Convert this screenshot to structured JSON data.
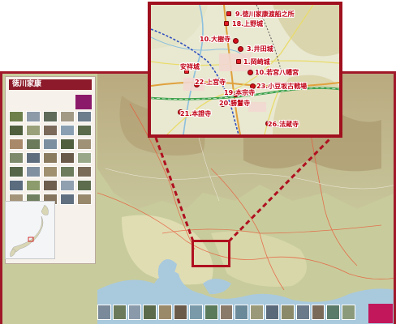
{
  "panel": {
    "title": "徳川家康",
    "subtitle": "",
    "badge": ""
  },
  "colors": {
    "accent": "#a0182a",
    "pin": "#d10f1a"
  },
  "callout_sites": [
    {
      "id": "site-9",
      "label": "9.徳川家康渡船之所"
    },
    {
      "id": "site-18",
      "label": "18.上野城"
    },
    {
      "id": "site-10b",
      "label": "10.大樹寺"
    },
    {
      "id": "site-3",
      "label": "3.井田城"
    },
    {
      "id": "site-1",
      "label": "1.岡崎城"
    },
    {
      "id": "site-anjo",
      "label": "安祥城"
    },
    {
      "id": "site-10",
      "label": "10.若宮八幡宮"
    },
    {
      "id": "site-22",
      "label": "22.上宮寺"
    },
    {
      "id": "site-23",
      "label": "23.小豆坂古戦場"
    },
    {
      "id": "site-19",
      "label": "19.本宗寺"
    },
    {
      "id": "site-20",
      "label": "20.勝鬘寺"
    },
    {
      "id": "site-21",
      "label": "21.本證寺"
    },
    {
      "id": "site-26",
      "label": "26.法蔵寺"
    }
  ],
  "photo_colors": [
    "#6d7f4a",
    "#8d9aa8",
    "#5f6b5a",
    "#a39a86",
    "#6e7d8c",
    "#4f5f3e",
    "#9aa07a",
    "#7b6a5a",
    "#8aa0b2",
    "#5a6a4a",
    "#a88a6a",
    "#6a7a5a",
    "#7c8fa0",
    "#50603f",
    "#9f9277",
    "#7e8a6c",
    "#5e6e7e",
    "#8a7a5e",
    "#6a5a4a",
    "#9aa88a",
    "#566648",
    "#8090a0",
    "#a09070",
    "#6c7c5c",
    "#7a6a58",
    "#5a6c7e",
    "#8c9c6c",
    "#6e5e4e",
    "#90a0b0",
    "#5c6c4c",
    "#a4947a",
    "#708060",
    "#84745e",
    "#607080",
    "#98886c"
  ],
  "strip_colors": [
    "#7a8a9a",
    "#6a7a5a",
    "#8a9aaa",
    "#5a6a4a",
    "#9a8a6a",
    "#6a5a4a",
    "#7a9aaa",
    "#5a7a5a",
    "#8a7a6a",
    "#6a8a9a",
    "#9a9a7a",
    "#5a6a7a",
    "#8a8a6a",
    "#6a7a8a",
    "#7a6a5a",
    "#5a7a6a",
    "#8a9a7a"
  ]
}
